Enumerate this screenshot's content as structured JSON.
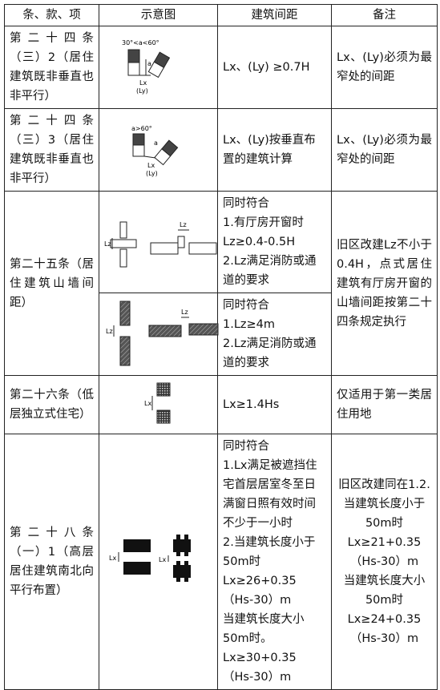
{
  "headers": {
    "item": "条、款、项",
    "diagram": "示意图",
    "spacing": "建筑间距",
    "remarks": "备注"
  },
  "rows": [
    {
      "item": "第二十四条（三）2（居住建筑既非垂直也非平行）",
      "diagram_labels": [
        "30°<a<60°",
        "a",
        "Lx",
        "(Ly)"
      ],
      "spacing": "Lx、(Ly) ≥0.7H",
      "remarks": "Lx、(Ly)必须为最窄处的间距"
    },
    {
      "item": "第二十四条（三）3（居住建筑既非垂直也非平行）",
      "diagram_labels": [
        "a>60°",
        "a",
        "Lx",
        "(Ly)"
      ],
      "spacing": "Lx、(Ly)按垂直布置的建筑计算",
      "remarks": "Lx、(Ly)必须为最窄处的间距"
    },
    {
      "item": "第二十五条（居住建筑山墙间距）",
      "diagram_labels_a": [
        "Lz",
        "Lz"
      ],
      "spacing_a": "同时符合\n1.有厅房开窗时Lz≥0.4-0.5H\n2.Lz满足消防或通道的要求",
      "diagram_labels_b": [
        "Lz",
        "Lz"
      ],
      "spacing_b": "同时符合\n1.Lz≥4m\n2.Lz满足消防或通道的要求",
      "remarks": "旧区改建Lz不小于0.4H，点式居住建筑有厅房开窗的山墙间距按第二十四条规定执行"
    },
    {
      "item": "第二十六条（低层独立式住宅）",
      "diagram_labels": [
        "Lx"
      ],
      "spacing": "Lx≥1.4Hs",
      "remarks": "仅适用于第一类居住用地"
    },
    {
      "item": "第二十八条（一）1（高层居住建筑南北向平行布置）",
      "diagram_labels": [
        "Lx",
        "Lx"
      ],
      "spacing": "同时符合\n1.Lx满足被遮挡住宅首层居室冬至日满窗日照有效时间不少于一小时\n2.当建筑长度小于50m时Lx≥26+0.35（Hs-30）m\n当建筑长度大小50m时。\nLx≥30+0.35（Hs-30）m",
      "remarks": "旧区改建同在1.2.当建筑长度小于50m时Lx≥21+0.35（Hs-30）m\n当建筑长度大小50m时Lx≥24+0.35（Hs-30）m"
    }
  ]
}
